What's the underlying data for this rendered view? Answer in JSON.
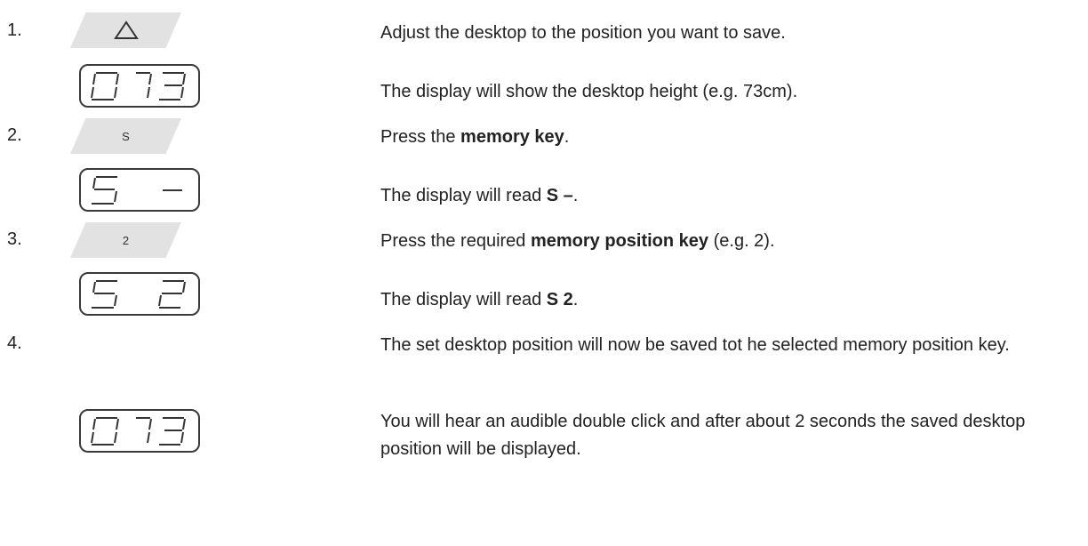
{
  "steps": [
    {
      "number": "1.",
      "key_icon": "triangle-up-icon",
      "display_icon": "seven-segment-display-073",
      "text_action": "Adjust the desktop to the position you want to save.",
      "text_result": "The display will show the desktop height (e.g. 73cm)."
    },
    {
      "number": "2.",
      "key_label": "S",
      "display_icon": "seven-segment-display-S-dash",
      "text_action_pre": "Press the ",
      "text_action_bold": "memory key",
      "text_action_post": ".",
      "text_result_pre": "The display will read ",
      "text_result_bold": "S –",
      "text_result_post": "."
    },
    {
      "number": "3.",
      "key_label": "2",
      "display_icon": "seven-segment-display-S-2",
      "text_action_pre": "Press the required ",
      "text_action_bold": "memory position key",
      "text_action_post": " (e.g. 2).",
      "text_result_pre": "The display will read ",
      "text_result_bold": "S 2",
      "text_result_post": "."
    },
    {
      "number": "4.",
      "display_icon": "seven-segment-display-073",
      "text_action": "The set desktop position will now be saved tot he selected memory position key.",
      "text_result": "You will hear an audible double click and after about 2 seconds the saved desktop position will be displayed."
    }
  ]
}
